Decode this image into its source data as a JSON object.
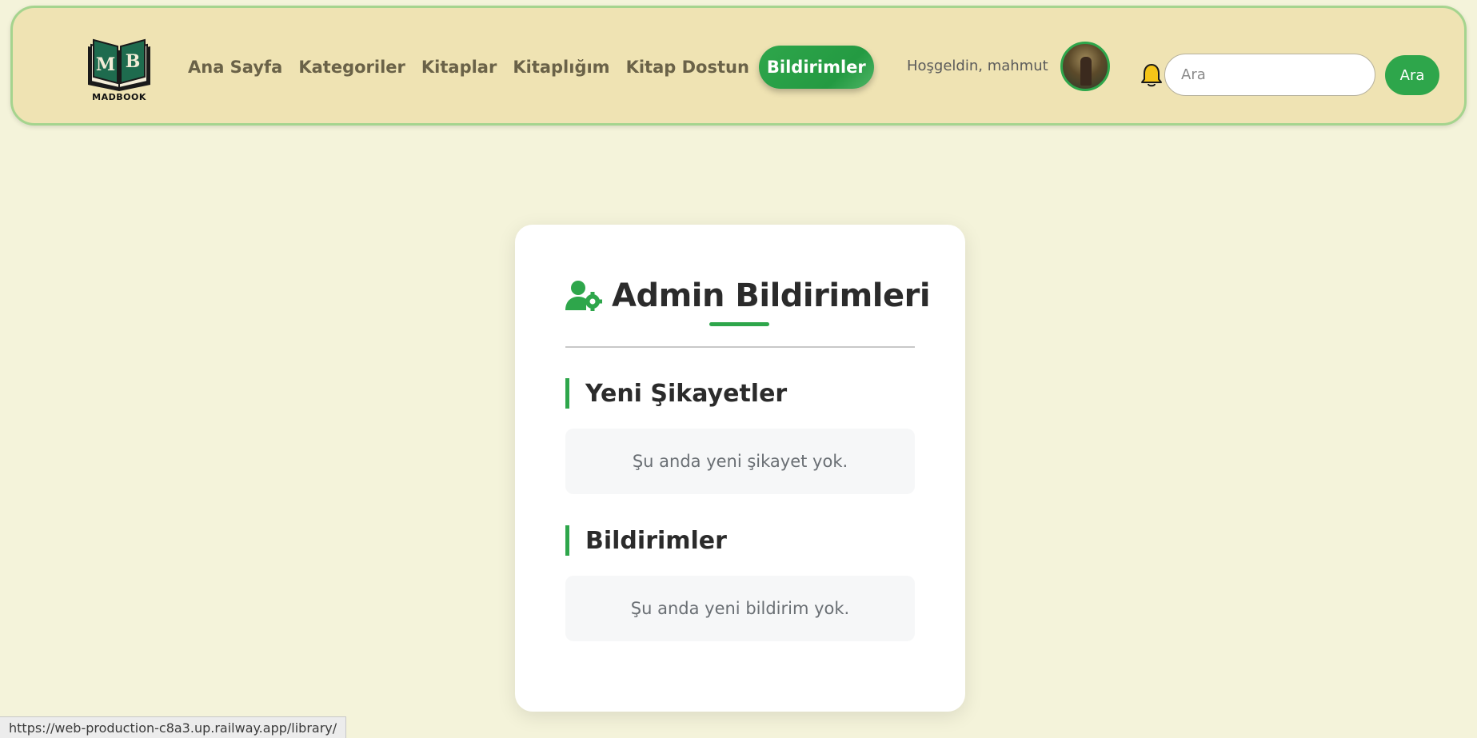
{
  "header": {
    "logo": {
      "monogram_left": "M",
      "monogram_right": "B",
      "wordmark": "MADBOOK"
    },
    "nav": [
      {
        "label": "Ana Sayfa",
        "active": false
      },
      {
        "label": "Kategoriler",
        "active": false
      },
      {
        "label": "Kitaplar",
        "active": false
      },
      {
        "label": "Kitaplığım",
        "active": false
      },
      {
        "label": "Kitap Dostun",
        "active": false
      },
      {
        "label": "Bildirimler",
        "active": true
      }
    ],
    "welcome_text": "Hoşgeldin, mahmut",
    "avatar_icon": "user-avatar",
    "bell_icon": "bell-icon",
    "search": {
      "placeholder": "Ara",
      "value": "",
      "button_label": "Ara"
    }
  },
  "card": {
    "title_icon": "user-gear-icon",
    "title": "Admin Bildirimleri",
    "sections": [
      {
        "heading": "Yeni Şikayetler",
        "empty_message": "Şu anda yeni şikayet yok."
      },
      {
        "heading": "Bildirimler",
        "empty_message": "Şu anda yeni bildirim yok."
      }
    ]
  },
  "status_bar": {
    "url": "https://web-production-c8a3.up.railway.app/library/"
  },
  "colors": {
    "page_background": "#f4f3da",
    "header_background": "#efe3b3",
    "header_border": "#a5d48e",
    "accent_green": "#2ea64b",
    "nav_text": "#6a6248",
    "bell_yellow": "#f5c518",
    "logo_green": "#1e6b4e"
  }
}
